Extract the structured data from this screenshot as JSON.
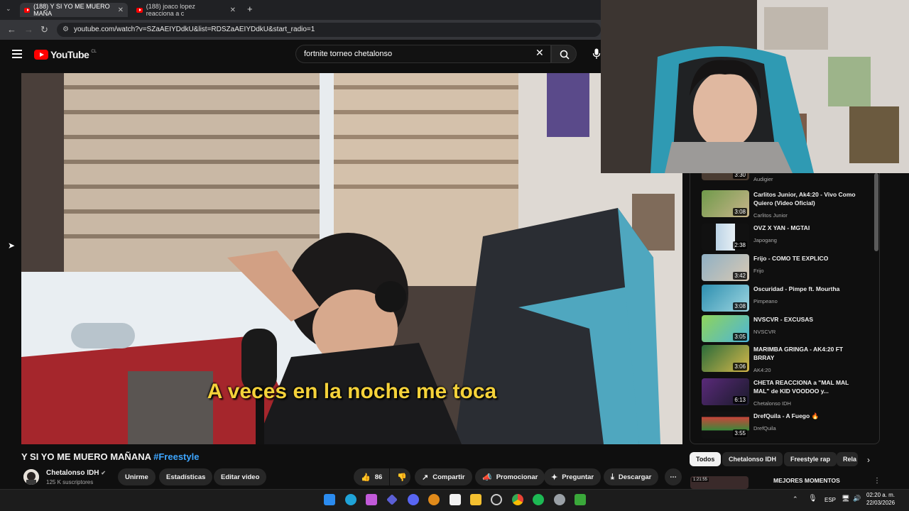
{
  "browser": {
    "tabs": [
      {
        "title": "(188) Y SI YO ME MUERO MAÑA",
        "active": true
      },
      {
        "title": "(188) joaco lopez reacciona a c",
        "active": false
      }
    ],
    "new_tab": "+",
    "url": "youtube.com/watch?v=SZaAEIYDdkU&list=RDSZaAEIYDdkU&start_radio=1"
  },
  "header": {
    "logo_text": "YouTube",
    "country": "CL",
    "search_value": "fortnite torneo chetalonso"
  },
  "video": {
    "caption": "A veces en la noche me toca",
    "title": "Y SI YO ME MUERO MAÑANA",
    "hashtag": "#Freestyle",
    "channel": "Chetalonso IDH",
    "subscribers": "125 K suscriptores"
  },
  "actions": {
    "join": "Unirme",
    "stats": "Estadísticas",
    "edit": "Editar video",
    "likes": "86",
    "share": "Compartir",
    "promote": "Promocionar",
    "ask": "Preguntar",
    "download": "Descargar"
  },
  "playlist": [
    {
      "title": "",
      "channel": "Audigier",
      "duration": "3:30"
    },
    {
      "title": "Carlitos Junior, Ak4:20 - Vivo Como Quiero (Video Oficial)",
      "channel": "Carlitos Junior",
      "duration": "3:08"
    },
    {
      "title": "OVZ X YAN - MGTAI",
      "channel": "Japogang",
      "duration": "2:38"
    },
    {
      "title": "Frijo - COMO TE EXPLICO",
      "channel": "Frijo",
      "duration": "3:42"
    },
    {
      "title": "Oscuridad - Pimpe ft. Mourtha",
      "channel": "Pimpeano",
      "duration": "3:08"
    },
    {
      "title": "NVSCVR - EXCUSAS",
      "channel": "NVSCVR",
      "duration": "3:05"
    },
    {
      "title": "MARIMBA GRINGA - AK4:20 FT BRRAY",
      "channel": "AK4:20",
      "duration": "3:06"
    },
    {
      "title": "CHETA REACCIONA a \"MAL MAL MAL\" de KID VOODOO y...",
      "channel": "Chetalonso IDH",
      "duration": "6:13"
    },
    {
      "title": "DrefQuila - A Fuego 🔥",
      "channel": "DrefQuila",
      "duration": "3:55"
    }
  ],
  "chips": [
    "Todos",
    "Chetalonso IDH",
    "Freestyle rap",
    "Rela"
  ],
  "next_item": {
    "title": "MEJORES MOMENTOS",
    "duration": "1:21:55"
  },
  "taskbar": {
    "lang": "ESP",
    "time": "02:20 a. m.",
    "date": "22/03/2026"
  }
}
